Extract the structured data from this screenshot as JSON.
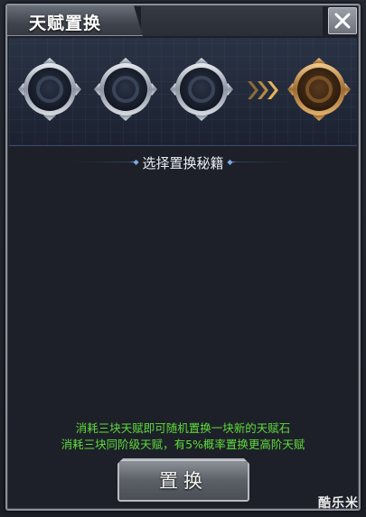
{
  "window": {
    "title": "天赋置换"
  },
  "slots": [
    {
      "type": "silver",
      "state": "empty"
    },
    {
      "type": "silver",
      "state": "empty"
    },
    {
      "type": "silver",
      "state": "empty"
    },
    {
      "type": "gold",
      "state": "result"
    }
  ],
  "colors": {
    "info_text": "#5fdc3c",
    "accent_line": "#4d7fbf",
    "gold_ring": "#b07a3a"
  },
  "section": {
    "select_label": "选择置换秘籍"
  },
  "info": {
    "line1": "消耗三块天赋即可随机置换一块新的天赋石",
    "line2": "消耗三块同阶级天赋，有5%概率置换更高阶天赋"
  },
  "actions": {
    "swap_label": "置换"
  },
  "watermark": {
    "text": "酷乐米"
  }
}
